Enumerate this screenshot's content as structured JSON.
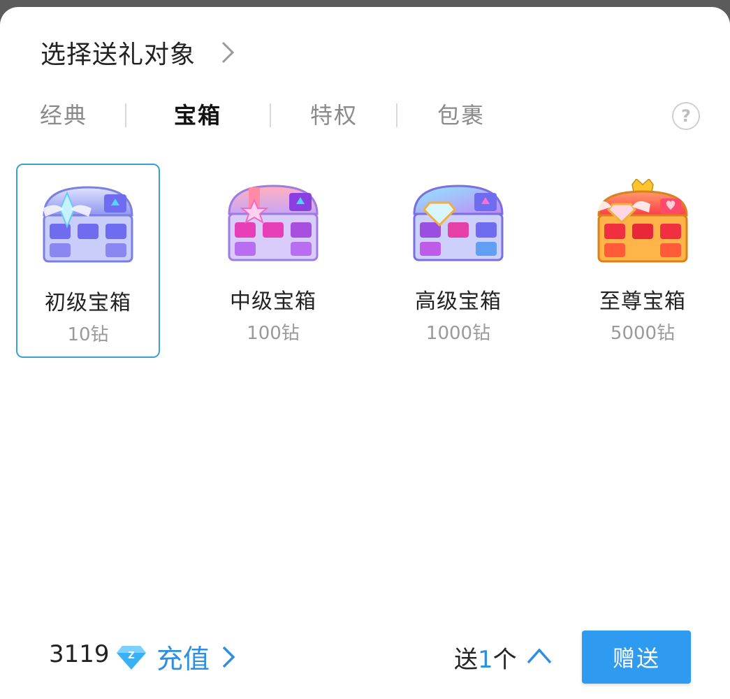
{
  "header": {
    "title": "选择送礼对象",
    "chevron_icon": "chevron-right-icon"
  },
  "tabs": [
    {
      "label": "经典",
      "active": false
    },
    {
      "label": "宝箱",
      "active": true
    },
    {
      "label": "特权",
      "active": false
    },
    {
      "label": "包裹",
      "active": false
    }
  ],
  "help_icon": {
    "symbol": "?",
    "icon": "help-circle-icon"
  },
  "gifts": [
    {
      "name": "初级宝箱",
      "price": "10钻",
      "selected": true,
      "icon": "treasure-chest-basic-icon"
    },
    {
      "name": "中级宝箱",
      "price": "100钻",
      "selected": false,
      "icon": "treasure-chest-intermediate-icon"
    },
    {
      "name": "高级宝箱",
      "price": "1000钻",
      "selected": false,
      "icon": "treasure-chest-advanced-icon"
    },
    {
      "name": "至尊宝箱",
      "price": "5000钻",
      "selected": false,
      "icon": "treasure-chest-supreme-icon"
    }
  ],
  "footer": {
    "balance": "3119",
    "diamond_icon": "diamond-icon",
    "recharge_label": "充值",
    "send_prefix": "送",
    "send_count": "1",
    "send_suffix": "个",
    "send_button": "赠送"
  },
  "colors": {
    "accent": "#2e9bf0",
    "selected_border": "#3aa1d8",
    "link": "#2e8fe0"
  }
}
